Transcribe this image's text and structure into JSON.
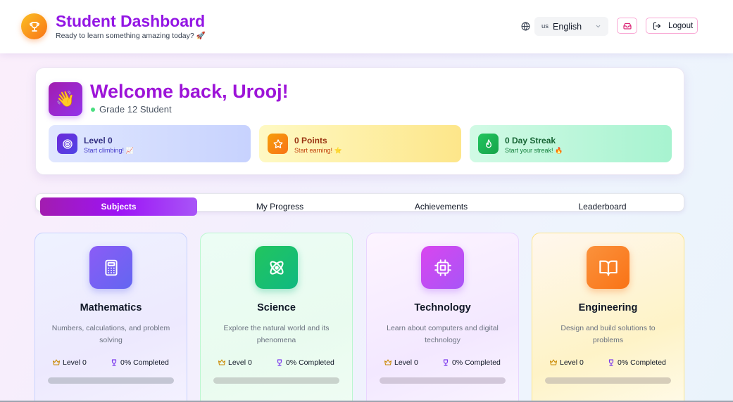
{
  "header": {
    "title": "Student Dashboard",
    "subtitle": "Ready to learn something amazing today? 🚀",
    "language": {
      "flag": "us",
      "label": "English"
    },
    "logout_label": "Logout"
  },
  "welcome": {
    "title": "Welcome back, Urooj!",
    "grade": "Grade 12 Student",
    "stats": {
      "level": {
        "title": "Level 0",
        "sub": "Start climbing! 📈"
      },
      "points": {
        "title": "0 Points",
        "sub": "Start earning! ⭐"
      },
      "streak": {
        "title": "0 Day Streak",
        "sub": "Start your streak! 🔥"
      }
    }
  },
  "tabs": [
    {
      "label": "Subjects",
      "active": true
    },
    {
      "label": "My Progress",
      "active": false
    },
    {
      "label": "Achievements",
      "active": false
    },
    {
      "label": "Leaderboard",
      "active": false
    }
  ],
  "subjects": [
    {
      "title": "Mathematics",
      "desc": "Numbers, calculations, and problem solving",
      "level": "Level 0",
      "completed": "0% Completed",
      "progress": 0.0,
      "icon": "calculator-icon"
    },
    {
      "title": "Science",
      "desc": "Explore the natural world and its phenomena",
      "level": "Level 0",
      "completed": "0% Completed",
      "progress": 0.0,
      "icon": "atom-icon"
    },
    {
      "title": "Technology",
      "desc": "Learn about computers and digital technology",
      "level": "Level 0",
      "completed": "0% Completed",
      "progress": 0.0,
      "icon": "cpu-icon"
    },
    {
      "title": "Engineering",
      "desc": "Design and build solutions to problems",
      "level": "Level 0",
      "completed": "0% Completed",
      "progress": 0.0,
      "icon": "book-open-icon"
    }
  ],
  "colors": {
    "brand_purple": "#9316e4",
    "accent_pink": "#f9a8d4",
    "active_tab": "#9d14f5"
  }
}
